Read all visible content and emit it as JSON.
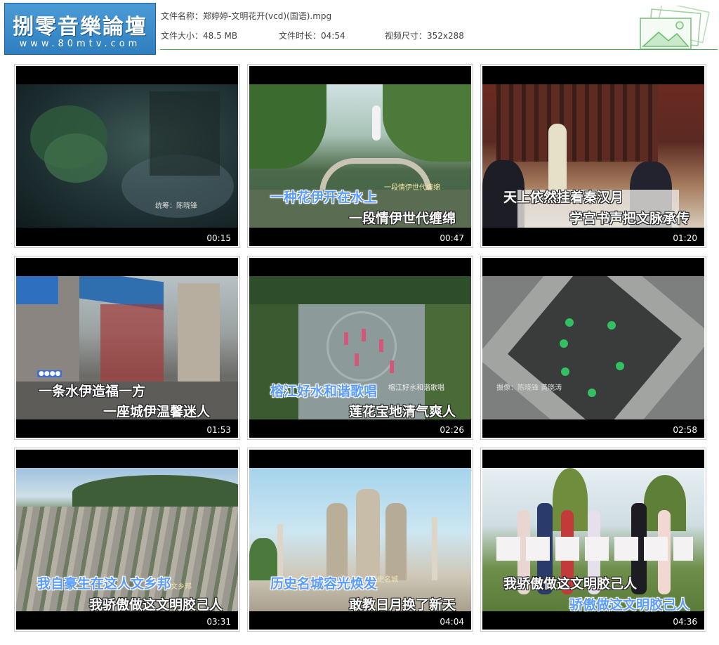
{
  "logo": {
    "title": "捌零音樂論壇",
    "url": "www.80mtv.com"
  },
  "file_info": {
    "name_label": "文件名称：",
    "name_value": "郑婷婷-文明花开(vcd)(国语).mpg",
    "size_label": "文件大小：",
    "size_value": "48.5 MB",
    "duration_label": "文件时长：",
    "duration_value": "04:54",
    "dimension_label": "视频尺寸：",
    "dimension_value": "352x288"
  },
  "colors": {
    "logo_bg": "#3b8ccb",
    "rule": "#4caf50",
    "lyric_blue": "#5a9cff"
  },
  "thumbnails": [
    {
      "time": "00:15",
      "lyric1": "",
      "lyric2": "",
      "caption": "统筹：陈晓锋"
    },
    {
      "time": "00:47",
      "lyric1": "一种花伊开在水上",
      "lyric2": "一段情伊世代缠绵",
      "caption": "一段情伊世代缠绵"
    },
    {
      "time": "01:20",
      "lyric1": "天上依然挂着秦汉月",
      "lyric2": "学宫书声把文脉承传",
      "caption": ""
    },
    {
      "time": "01:53",
      "lyric1": "一条水伊造福一方",
      "lyric2": "一座城伊温馨迷人",
      "caption": ""
    },
    {
      "time": "02:26",
      "lyric1": "榕江好水和谐歌唱",
      "lyric2": "莲花宝地清气爽人",
      "caption": "榕江好水和谐歌唱"
    },
    {
      "time": "02:58",
      "lyric1": "",
      "lyric2": "",
      "caption": "摄像：陈晓锋 黄晓涛"
    },
    {
      "time": "03:31",
      "lyric1": "我自豪生在这人文乡邦",
      "lyric2": "我骄傲做这文明胶己人",
      "caption": "人文乡邦"
    },
    {
      "time": "04:04",
      "lyric1": "历史名城容光焕发",
      "lyric2": "敢教日月换了新天",
      "caption": "历史名城"
    },
    {
      "time": "04:36",
      "lyric1": "我骄傲做这文明胶己人",
      "lyric2": "骄傲做这文明胶己人",
      "caption": ""
    }
  ]
}
